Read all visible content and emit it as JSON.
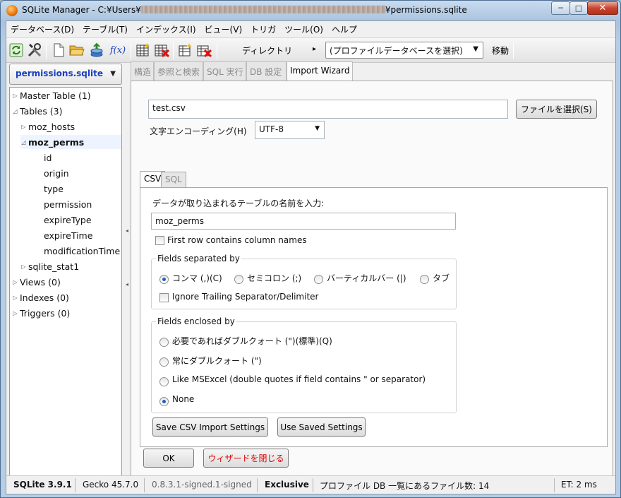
{
  "window": {
    "title_prefix": "SQLite Manager - C:¥Users¥",
    "title_suffix": "¥permissions.sqlite",
    "controls": {
      "minimize": "─",
      "maximize": "□",
      "close": "✕"
    }
  },
  "menubar": [
    "データベース(D)",
    "テーブル(T)",
    "インデックス(I)",
    "ビュー(V)",
    "トリガ",
    "ツール(O)",
    "ヘルプ"
  ],
  "toolbar": {
    "directory_label": "ディレクトリ",
    "arrow": "▸",
    "profile_select": "(プロファイルデータベースを選択)",
    "move_label": "移動",
    "function_label": "f(x)"
  },
  "sidebar": {
    "database_select": "permissions.sqlite",
    "tree": [
      {
        "label": "Master Table (1)",
        "twisty": "▷",
        "level": 0
      },
      {
        "label": "Tables (3)",
        "twisty": "◿",
        "level": 0
      },
      {
        "label": "moz_hosts",
        "twisty": "▷",
        "level": 1
      },
      {
        "label": "moz_perms",
        "twisty": "◿",
        "level": 1,
        "selected": true
      },
      {
        "label": "id",
        "twisty": "",
        "level": 2
      },
      {
        "label": "origin",
        "twisty": "",
        "level": 2
      },
      {
        "label": "type",
        "twisty": "",
        "level": 2
      },
      {
        "label": "permission",
        "twisty": "",
        "level": 2
      },
      {
        "label": "expireType",
        "twisty": "",
        "level": 2
      },
      {
        "label": "expireTime",
        "twisty": "",
        "level": 2
      },
      {
        "label": "modificationTime",
        "twisty": "",
        "level": 2
      },
      {
        "label": "sqlite_stat1",
        "twisty": "▷",
        "level": 1
      },
      {
        "label": "Views (0)",
        "twisty": "▷",
        "level": 0
      },
      {
        "label": "Indexes (0)",
        "twisty": "▷",
        "level": 0
      },
      {
        "label": "Triggers (0)",
        "twisty": "▷",
        "level": 0
      }
    ]
  },
  "tabs": [
    "構造",
    "参照と検索",
    "SQL 実行",
    "DB 設定",
    "Import Wizard"
  ],
  "wizard": {
    "file_value": "test.csv",
    "choose_file_button": "ファイルを選択(S)",
    "encoding_label": "文字エンコーディング(H)",
    "encoding_value": "UTF-8",
    "subtabs": [
      "CSV",
      "SQL"
    ],
    "csv": {
      "table_name_label": "データが取り込まれるテーブルの名前を入力:",
      "table_name_value": "moz_perms",
      "first_row_label": "First row contains column names",
      "separated_title": "Fields separated by",
      "sep_comma": "コンマ (,)(C)",
      "sep_semicolon": "セミコロン (;)",
      "sep_pipe": "バーティカルバー (|)",
      "sep_tab": "タブ",
      "ignore_trailing": "Ignore Trailing Separator/Delimiter",
      "enclosed_title": "Fields enclosed by",
      "enc_optional": "必要であればダブルクォート (\")(標準)(Q)",
      "enc_always": "常にダブルクォート (\")",
      "enc_msexcel": "Like MSExcel (double quotes if field contains \" or separator)",
      "enc_none": "None",
      "save_settings_button": "Save CSV Import Settings",
      "use_saved_button": "Use Saved Settings"
    },
    "ok_button": "OK",
    "close_wizard_button": "ウィザードを閉じる",
    "close_wizard_color": "#e00000"
  },
  "statusbar": {
    "sqlite_version": "SQLite 3.9.1",
    "gecko_version": "Gecko 45.7.0",
    "addon_version": "0.8.3.1-signed.1-signed",
    "lock_mode": "Exclusive",
    "profile_count": "プロファイル DB 一覧にあるファイル数: 14",
    "elapsed": "ET: 2 ms"
  },
  "colors": {
    "db_name": "#1a3fbf",
    "selected_radio": "#2a5db8"
  }
}
